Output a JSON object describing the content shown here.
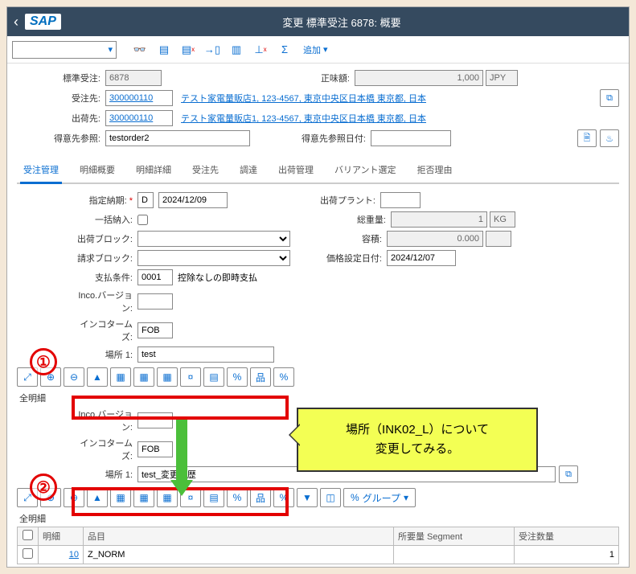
{
  "titlebar": {
    "title": "変更 標準受注 6878: 概要",
    "logo": "SAP"
  },
  "toolbar": {
    "add": "追加"
  },
  "header": {
    "order_lbl": "標準受注:",
    "order": "6878",
    "netval_lbl": "正味額:",
    "netval": "1,000",
    "curr": "JPY",
    "soldto_lbl": "受注先:",
    "soldto": "300000110",
    "soldto_link": "テスト家電量販店1, 123-4567, 東京中央区日本橋 東京都, 日本",
    "shipto_lbl": "出荷先:",
    "shipto": "300000110",
    "shipto_link": "テスト家電量販店1, 123-4567, 東京中央区日本橋 東京都, 日本",
    "custref_lbl": "得意先参照:",
    "custref": "testorder2",
    "custrefdate_lbl": "得意先参照日付:"
  },
  "tabs": [
    "受注管理",
    "明細概要",
    "明細詳細",
    "受注先",
    "調達",
    "出荷管理",
    "バリアント選定",
    "拒否理由"
  ],
  "order_mgmt": {
    "reqdate_lbl": "指定納期:",
    "reqdate_d": "D",
    "reqdate": "2024/12/09",
    "plant_lbl": "出荷プラント:",
    "compdlv_lbl": "一括納入:",
    "gweight_lbl": "総重量:",
    "gweight": "1",
    "gweight_u": "KG",
    "dlvblk_lbl": "出荷ブロック:",
    "vol_lbl": "容積:",
    "vol": "0.000",
    "billblk_lbl": "請求ブロック:",
    "prcdate_lbl": "価格設定日付:",
    "prcdate": "2024/12/07",
    "payterm_lbl": "支払条件:",
    "payterm": "0001",
    "payterm_txt": "控除なしの即時支払",
    "incov_lbl": "Inco.バージョン:",
    "incoterms_lbl": "インコタームズ:",
    "incoterms": "FOB",
    "loc1_lbl": "場所 1:",
    "loc1_val1": "test",
    "loc1_val2": "test_変更履歴"
  },
  "sections": {
    "allitems": "全明細"
  },
  "btns": {
    "group": "グループ"
  },
  "table": {
    "cols": [
      "明細",
      "品目",
      "所要量 Segment",
      "受注数量"
    ],
    "row": {
      "line": "10",
      "mat": "Z_NORM",
      "seg": "",
      "qty": "1"
    }
  },
  "annotation": {
    "callout_l1": "場所（INK02_L）について",
    "callout_l2": "変更してみる。"
  }
}
